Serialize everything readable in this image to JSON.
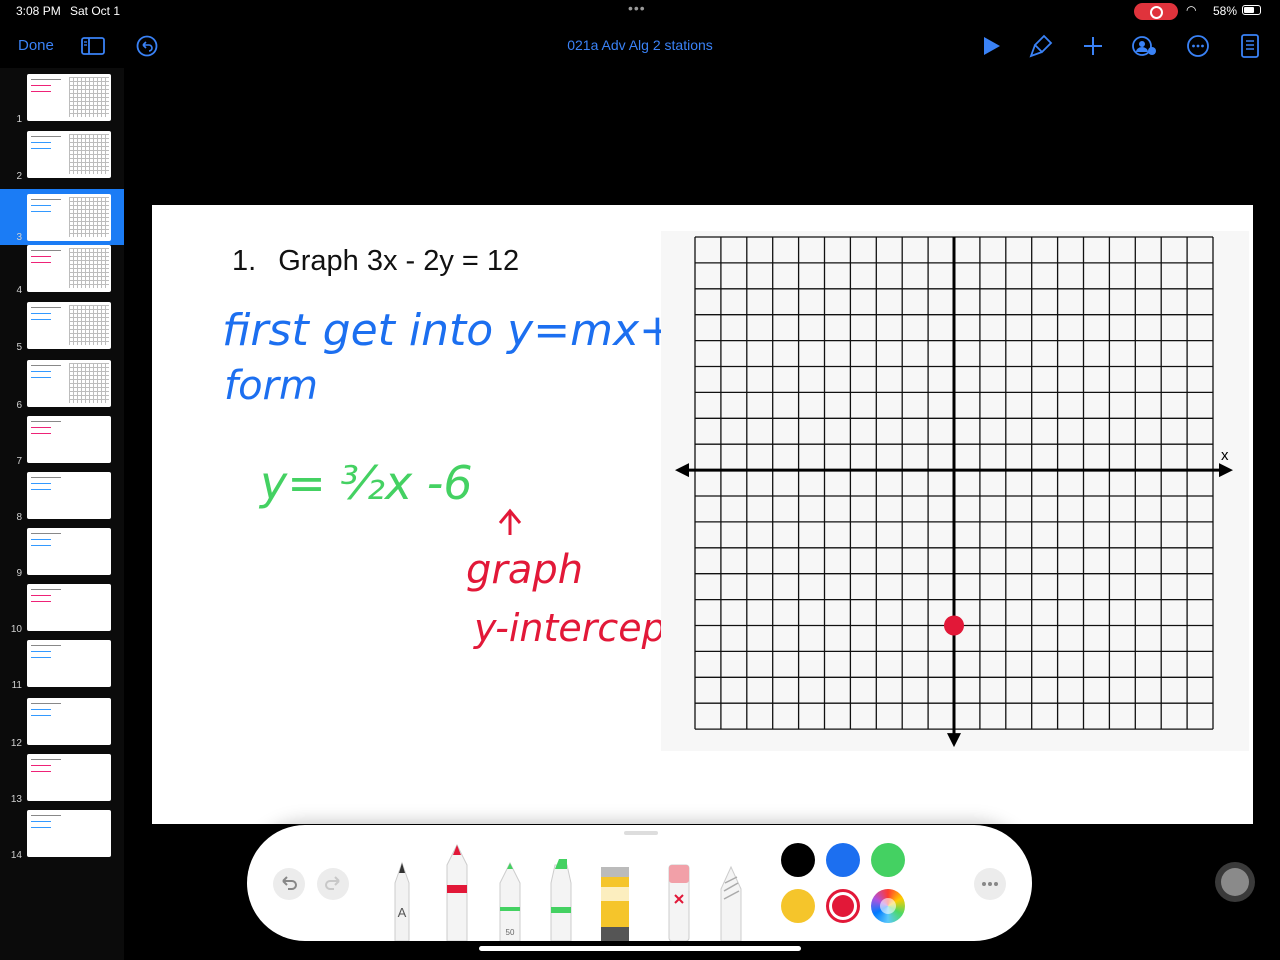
{
  "status_bar": {
    "time": "3:08 PM",
    "date": "Sat Oct 1",
    "battery": "58%"
  },
  "toolbar": {
    "done_label": "Done",
    "title": "021a Adv Alg 2 stations"
  },
  "sidebar": {
    "pages": [
      "1",
      "2",
      "3",
      "4",
      "5",
      "6",
      "7",
      "8",
      "9",
      "10",
      "11",
      "12",
      "13",
      "14"
    ],
    "active_page": 3
  },
  "page": {
    "problem_number": "1.",
    "problem_text": "Graph 3x - 2y = 12",
    "axis_x_label": "x",
    "handwriting": {
      "line1": "first  get into  y=mx+b",
      "line2": "form",
      "equation": "y=  ³⁄₂x  -6",
      "note1": "graph",
      "note2": "y-intercept"
    },
    "plotted_point": {
      "x": 0,
      "y": -6
    }
  },
  "palette": {
    "colors": [
      "#000000",
      "#1c6ff0",
      "#44d162",
      "#f5c52b",
      "#e21838",
      "rainbow"
    ],
    "selected_color": "#e21838",
    "pencil_size_label": "50",
    "pen_letter": "A"
  },
  "colors": {
    "accent": "#3a82f6",
    "blue_ink": "#1c6ff0",
    "green_ink": "#44d162",
    "red_ink": "#e21838"
  }
}
